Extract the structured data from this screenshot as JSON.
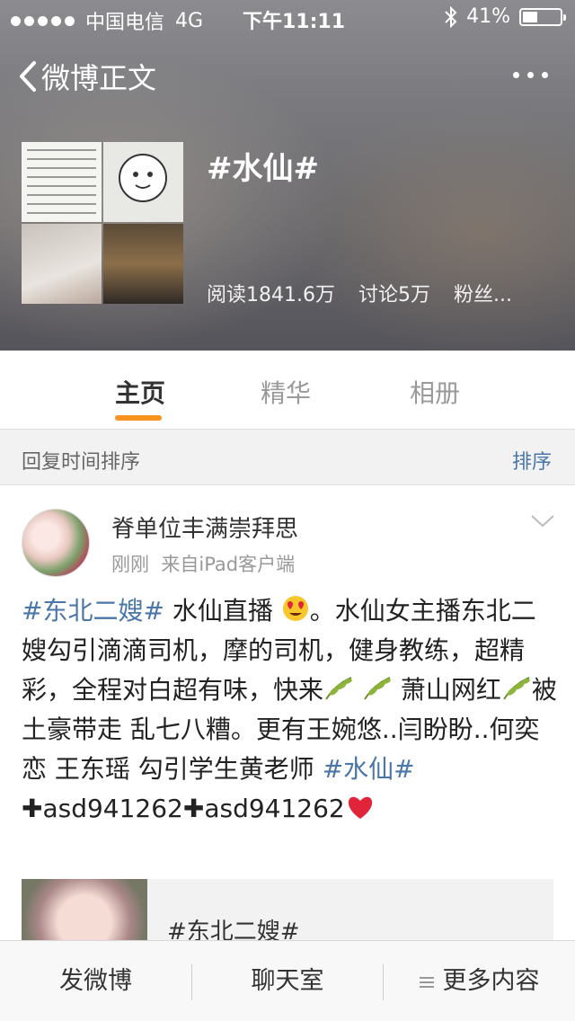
{
  "status_bar": {
    "carrier": "中国电信",
    "network": "4G",
    "time": "下午11:11",
    "battery": "41%"
  },
  "nav": {
    "back_label": "微博正文"
  },
  "topic": {
    "title": "#水仙#",
    "reads": "阅读1841.6万",
    "discussions": "讨论5万",
    "fans": "粉丝..."
  },
  "tabs": [
    {
      "label": "主页",
      "active": true
    },
    {
      "label": "精华",
      "active": false
    },
    {
      "label": "相册",
      "active": false
    }
  ],
  "sort": {
    "label": "回复时间排序",
    "button": "排序"
  },
  "post": {
    "username": "脊单位丰满崇拜思",
    "time": "刚刚",
    "source": "来自iPad客户端",
    "tag1": "#东北二嫂#",
    "text1": " 水仙直播",
    "text2": "。水仙女主播东北二嫂勾引滴滴司机，摩的司机，健身教练，超精彩，全程对白超有味，快来",
    "text3": " 萧山网红",
    "text4": "被土豪带走 乱七八糟。更有王婉悠..闫盼盼..何奕恋 王东瑶 勾引学生黄老师 ",
    "tag2": "#水仙#",
    "contact1": "asd941262",
    "contact2": "asd941262",
    "share_title": "#东北二嫂#"
  },
  "bottom_bar": {
    "compose": "发微博",
    "chat": "聊天室",
    "more": "更多内容"
  },
  "colors": {
    "accent_orange": "#f7931e",
    "link_blue": "#4a76a8"
  }
}
